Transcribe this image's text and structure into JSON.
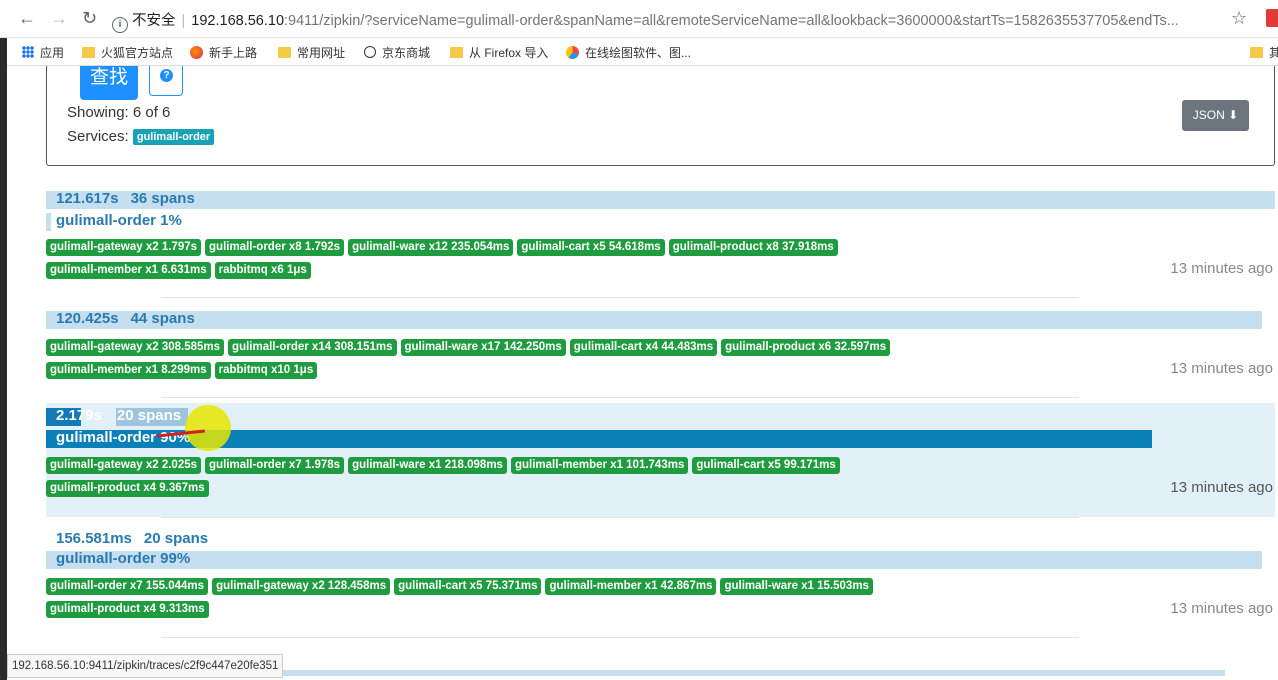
{
  "browser": {
    "back_icon": "arrow-left-icon",
    "forward_icon": "arrow-right-icon",
    "reload_icon": "reload-icon",
    "security_label": "不安全",
    "url_host": "192.168.56.10",
    "url_rest": ":9411/zipkin/?serviceName=gulimall-order&spanName=all&remoteServiceName=all&lookback=3600000&startTs=1582635537705&endTs...",
    "bookmarks": [
      "应用",
      "火狐官方站点",
      "新手上路",
      "常用网址",
      "京东商城",
      "从 Firefox 导入",
      "在线绘图软件、图..."
    ],
    "bookmark_right": "其"
  },
  "panel": {
    "search_button": "查找",
    "help_icon": "?",
    "showing": "Showing: 6 of 6",
    "services_label": "Services:",
    "service_badge": "gulimall-order",
    "json_button": "JSON"
  },
  "traces": [
    {
      "duration": "121.617s",
      "spans": "36 spans",
      "service_pct": "gulimall-order 1%",
      "row1": [
        "gulimall-gateway x2 1.797s",
        "gulimall-order x8 1.792s",
        "gulimall-ware x12 235.054ms",
        "gulimall-cart x5 54.618ms",
        "gulimall-product x8 37.918ms"
      ],
      "row2": [
        "gulimall-member x1 6.631ms",
        "rabbitmq x6 1μs"
      ],
      "ago": "13 minutes ago"
    },
    {
      "duration": "120.425s",
      "spans": "44 spans",
      "service_pct": "",
      "row1": [
        "gulimall-gateway x2 308.585ms",
        "gulimall-order x14 308.151ms",
        "gulimall-ware x17 142.250ms",
        "gulimall-cart x4 44.483ms",
        "gulimall-product x6 32.597ms"
      ],
      "row2": [
        "gulimall-member x1 8.299ms",
        "rabbitmq x10 1μs"
      ],
      "ago": "13 minutes ago"
    },
    {
      "duration": "2.179s",
      "spans": "20 spans",
      "service_pct": "gulimall-order 90%",
      "row1": [
        "gulimall-gateway x2 2.025s",
        "gulimall-order x7 1.978s",
        "gulimall-ware x1 218.098ms",
        "gulimall-member x1 101.743ms",
        "gulimall-cart x5 99.171ms"
      ],
      "row2": [
        "gulimall-product x4 9.367ms"
      ],
      "ago": "13 minutes ago"
    },
    {
      "duration": "156.581ms",
      "spans": "20 spans",
      "service_pct": "gulimall-order 99%",
      "row1": [
        "gulimall-order x7 155.044ms",
        "gulimall-gateway x2 128.458ms",
        "gulimall-cart x5 75.371ms",
        "gulimall-member x1 42.867ms",
        "gulimall-ware x1 15.503ms"
      ],
      "row2": [
        "gulimall-product x4 9.313ms"
      ],
      "ago": "13 minutes ago"
    }
  ],
  "status_url": "192.168.56.10:9411/zipkin/traces/c2f9c447e20fe351"
}
